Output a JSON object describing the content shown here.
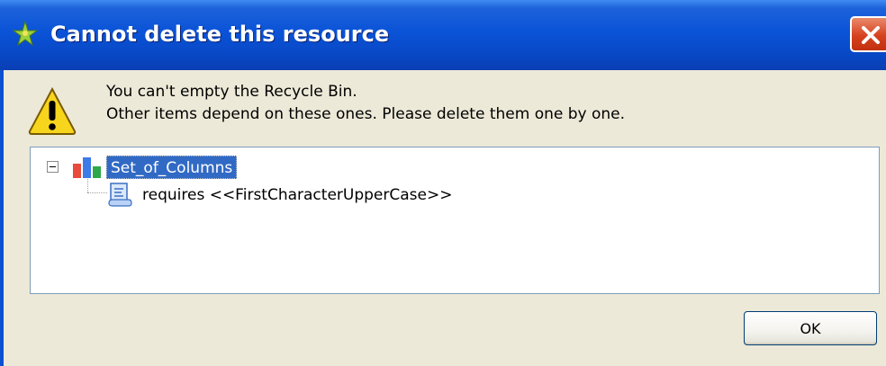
{
  "dialog": {
    "title": "Cannot delete this resource",
    "message_line1": "You can't empty the Recycle Bin.",
    "message_line2": "Other items depend on these ones. Please delete them one by one.",
    "ok_label": "OK"
  },
  "tree": {
    "root": {
      "label": "Set_of_Columns",
      "icon": "columns-set-icon",
      "expanded": true,
      "selected": true
    },
    "children": [
      {
        "label": "requires <<FirstCharacterUpperCase>>",
        "icon": "rule-document-icon"
      }
    ]
  },
  "colors": {
    "titlebar": "#0a53d8",
    "selection": "#316ac5",
    "dialog_bg": "#ece9d8"
  }
}
